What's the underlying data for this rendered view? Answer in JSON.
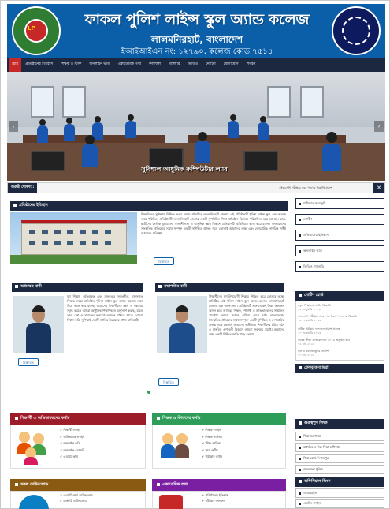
{
  "header": {
    "title": "ফাকল পুলিশ লাইন্স স্কুল অ্যান্ড কলেজ",
    "location": "লালমনিরহাট, বাংলাদেশ",
    "eiin": "ইআইআইএন নং: ১২৭৯০, কলেজ কোড ৭৫১৪",
    "logo_left_text": "LP"
  },
  "nav": {
    "items": [
      "হোম",
      "প্রতিষ্ঠানের ইতিহাস",
      "শিক্ষক ও স্টাফ",
      "অনলাইন ভর্তি",
      "একাডেমিক তথ্য",
      "ফলাফল",
      "গ্যালারি",
      "ভিডিও",
      "নোটিশ",
      "যোগাযোগ",
      "লগইন"
    ]
  },
  "hero": {
    "caption": "সুবিশাল আধুনিক কম্পিউটার ল্যাব",
    "prev": "‹",
    "next": "›"
  },
  "ticker": {
    "label": "জরুরী ঘোষণা :",
    "text": "এইচএসসি পরীক্ষার ফরম পূরণের বিজ্ঞপ্তি প্রকাশ",
    "close": "✕"
  },
  "history": {
    "title": "প্রতিষ্ঠানের ইতিহাস",
    "text": "শিক্ষাবিদের সুশিক্ষায় শিক্ষিত করার লক্ষ্যে প্রতিষ্ঠিত লালমনিরহাট জেলার এই প্রতিষ্ঠানটি পুলিশ লাইন্স স্কুল এন্ড কলেজ নামে পরিচিত। প্রতিষ্ঠানটি লালমনিরহাট জেলার একটি সুপরিচিত শিক্ষা প্রতিষ্ঠান হিসেবে পরিচালিত হয়ে আসছে। ছাত্র-ছাত্রীদের নৈতিক মূল্যবোধ, সৃজনশীলতা ও আধুনিক জ্ঞান বিকাশে প্রতিষ্ঠানটি প্রতিনিয়ত কাজ করে যাচ্ছে। বাংলাদেশের সাংস্কৃতিক ঐতিহ্যের সাথে সম্পৃক্ত একটি সুশিক্ষিত প্রজন্ম গড়ে তোলাই আমাদের লক্ষ্য এবং দেশপ্রেমিক নাগরিক সৃষ্টিই আমাদের প্রতিজ্ঞা...",
    "more": "বিস্তারিত"
  },
  "principal": {
    "title": "অধ্যক্ষের বাণী",
    "text": "যুগ শিক্ষায় অতিবাহক এবং মানবতার সৃজনশীল, মানসম্মত শিক্ষার লক্ষ্যে প্রতিষ্ঠিত পুলিশ লাইন্স স্কুল অ্যান্ড কলেজ লক্ষ্য নিয়ে কাজ করে যাচ্ছে। আমাদের শিক্ষার্থীদের জ্ঞান ও দক্ষতায় সমৃদ্ধ করতে আমরা আধুনিক শিক্ষাপদ্ধতি অনুসরণ করছি, যাতে তারা দেশ ও সমাজের কল্যাণে অবদান রাখতে পারে। আমরা বিশ্বাস করি, সুশিক্ষাই একটি জাতির উন্নয়নের প্রধান চাবিকাঠি।",
    "more": "বিস্তারিত"
  },
  "president": {
    "title": "সভাপতির বাণী",
    "text": "শিক্ষার্থীদের যুগ-উপযোগী শিক্ষায় শিক্ষিত করে তোলার লক্ষ্যে প্রতিষ্ঠিত এই পুলিশ লাইন্স স্কুল অ্যান্ড কলেজ লালমনিরহাট জেলায় এক অনন্য নাম। প্রতিষ্ঠানটি শুরু থেকেই উত্তম ফলাফল অর্জন করে আসছে। শিক্ষক, শিক্ষার্থী ও অভিভাবকদের সম্মিলিত প্রচেষ্টায় আমরা আরও এগিয়ে যেতে চাই। বাংলাদেশের সাংস্কৃতিক ঐতিহ্যের সাথে সম্পৃক্ত একটি সুশিক্ষিত ও দেশপ্রেমিক প্রজন্ম গড়ে তোলাই আমাদের অঙ্গীকার। শিক্ষার্থীদের চরিত্র গঠন ও মানবিক গুণাবলী বিকাশে আমরা সবসময় সচেষ্ট। আমাদের লক্ষ্য একটি শিক্ষিত জাতি গড়ে তোলা।",
    "more": "বিস্তারিত"
  },
  "sidebar": {
    "links": [
      "পরীক্ষার সময়সূচি",
      "নোটিশ",
      "প্রতিষ্ঠানের ইতিহাস",
      "অনলাইন ভর্তি",
      "ভিডিও গ্যালারি"
    ],
    "notice_title": "নোটিশ বোর্ড",
    "notices": [
      {
        "text": "নতুন শিক্ষাবর্ষে ভর্তির বিজ্ঞপ্তি",
        "date": "১২ জানুয়ারি ২০২৪"
      },
      {
        "text": "এসএসসি পরীক্ষার প্রবেশপত্র বিতরণ সংক্রান্ত বিজ্ঞপ্তি",
        "date": "০৫ ফেব্রুয়ারি ২০২৪"
      },
      {
        "text": "বার্ষিক পরীক্ষার ফলাফল প্রকাশ প্রসঙ্গে",
        "date": "২০ ফেব্রুয়ারি ২০২৪"
      },
      {
        "text": "বার্ষিক ক্রীড়া প্রতিযোগিতা ২০২৪ অনুষ্ঠিত হবে",
        "date": "০২ মার্চ ২০২৪"
      },
      {
        "text": "স্কুল ও কলেজ ছুটির নোটিশ",
        "date": "১০ মার্চ ২০২৪"
      }
    ],
    "facebook_title": "ফেসবুকে আমরা",
    "important_title": "গুরুত্বপূর্ণ লিংক",
    "important_links": [
      "শিক্ষা মন্ত্রণালয়",
      "মাধ্যমিক ও উচ্চ শিক্ষা অধিদপ্তর",
      "শিক্ষা বোর্ড দিনাজপুর",
      "বাংলাদেশ পুলিশ"
    ],
    "admin_title": "অফিসিয়াল লিংক",
    "admin_links": [
      "ওয়েবমেইল",
      "এডমিন লগইন"
    ]
  },
  "cards": {
    "students": {
      "title": "শিক্ষার্থী ও অভিভাবকদের কর্নার",
      "items": [
        "শিক্ষার্থী লগইন",
        "অভিভাবক লগইন",
        "অনলাইন ভর্তি",
        "অনলাইন রেজাল্ট",
        "এডমিট কার্ড"
      ]
    },
    "teachers": {
      "title": "শিক্ষক ও স্টাফদের কর্নার",
      "items": [
        "শিক্ষক লগইন",
        "শিক্ষক তালিকা",
        "স্টাফ তালিকা",
        "ক্লাস রুটিন",
        "পরীক্ষার রুটিন"
      ]
    },
    "downloads": {
      "title": "সকল ডাউনলোড",
      "items": [
        "এডমিট কার্ড ডাউনলোড",
        "মার্কশিট ডাউনলোড"
      ]
    },
    "academic": {
      "title": "একাডেমিক তথ্য",
      "items": [
        "প্রতিষ্ঠানের ইতিহাস",
        "পরীক্ষার ফলাফল"
      ]
    }
  },
  "colors": {
    "header_blue": "#0b5fa8",
    "nav_dark": "#1c2840",
    "accent_red": "#c62828",
    "card_students": "#9c1c2a",
    "card_teachers": "#2e9d5a",
    "card_downloads": "#8a5a12",
    "card_academic": "#7b1fa2"
  }
}
